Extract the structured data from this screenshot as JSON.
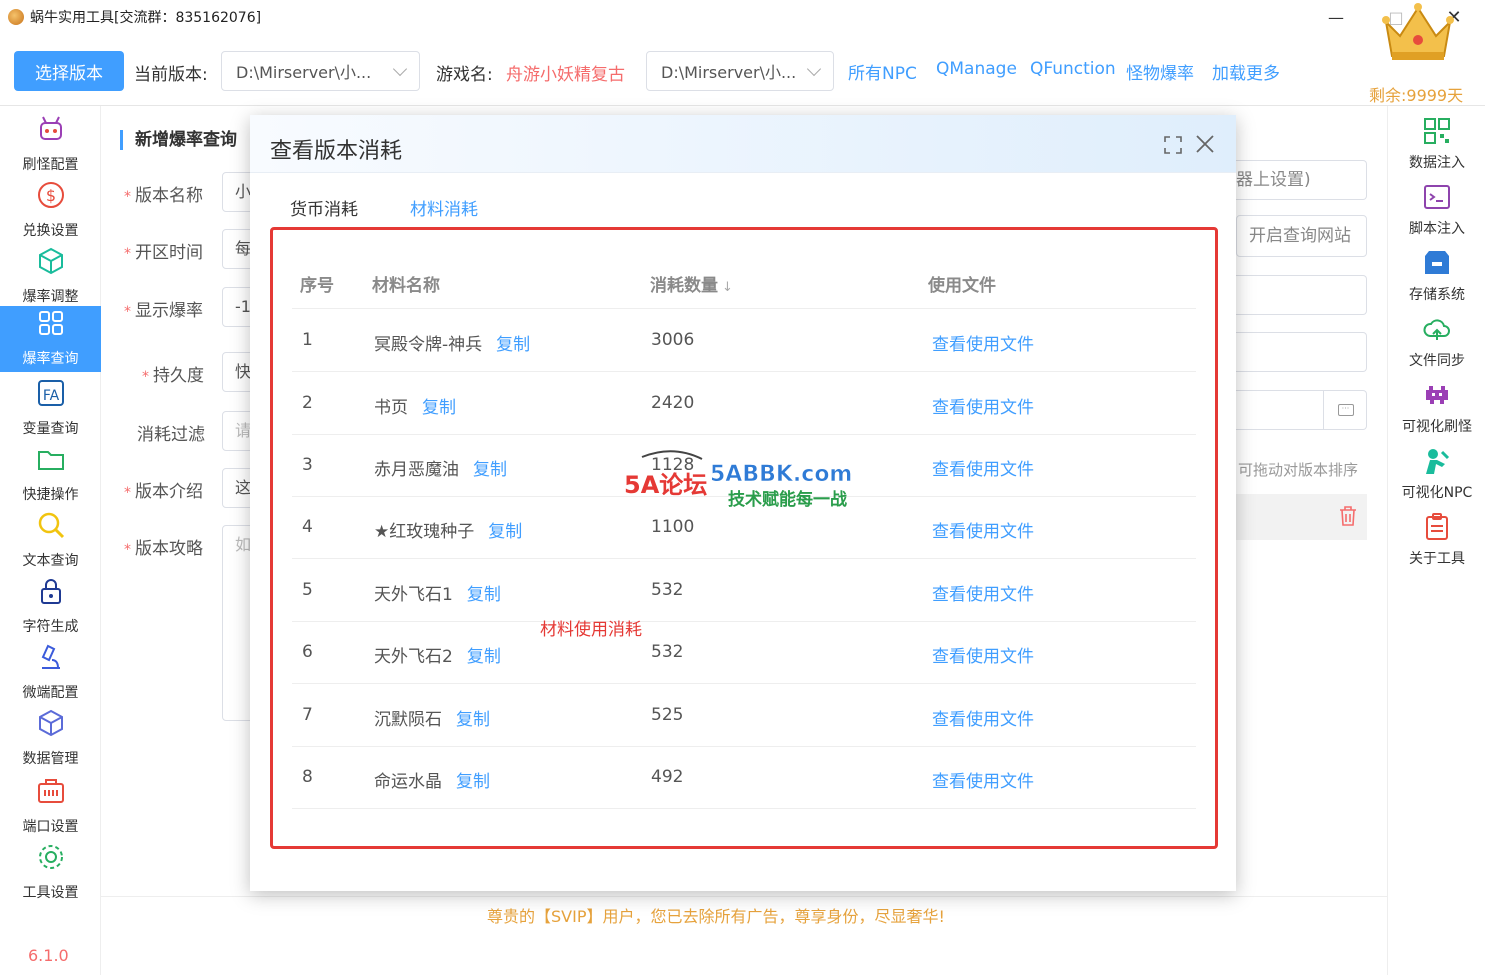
{
  "window": {
    "title": "蜗牛实用工具[交流群：835162076]",
    "minimize": "—",
    "maximize": "□",
    "close": "✕"
  },
  "toolbar": {
    "select_version_button": "选择版本",
    "current_version_label": "当前版本:",
    "current_version_value": "D:\\Mirserver\\小...",
    "game_name_label": "游戏名:",
    "game_name_value": "舟游小妖精复古",
    "server_path_value": "D:\\Mirserver\\小...",
    "links": [
      "所有NPC",
      "QManage",
      "QFunction",
      "怪物爆率",
      "加载更多"
    ],
    "remaining": "剩余:9999天"
  },
  "sidebar_left": {
    "items": [
      {
        "label": "刷怪配置",
        "icon": "robot-icon"
      },
      {
        "label": "兑换设置",
        "icon": "dollar-icon"
      },
      {
        "label": "爆率调整",
        "icon": "cube-icon"
      },
      {
        "label": "爆率查询",
        "icon": "grid-icon",
        "active": true
      },
      {
        "label": "变量查询",
        "icon": "formula-icon"
      },
      {
        "label": "快捷操作",
        "icon": "folder-icon"
      },
      {
        "label": "文本查询",
        "icon": "search-icon"
      },
      {
        "label": "字符生成",
        "icon": "lock-icon"
      },
      {
        "label": "微端配置",
        "icon": "microscope-icon"
      },
      {
        "label": "数据管理",
        "icon": "box-icon"
      },
      {
        "label": "端口设置",
        "icon": "port-icon"
      },
      {
        "label": "工具设置",
        "icon": "gear-icon"
      }
    ],
    "version": "6.1.0"
  },
  "sidebar_right": {
    "items": [
      {
        "label": "数据注入",
        "icon": "qr-icon"
      },
      {
        "label": "脚本注入",
        "icon": "terminal-icon"
      },
      {
        "label": "存储系统",
        "icon": "storage-icon"
      },
      {
        "label": "文件同步",
        "icon": "cloud-sync-icon"
      },
      {
        "label": "可视化刷怪",
        "icon": "invader-icon"
      },
      {
        "label": "可视化NPC",
        "icon": "npc-icon"
      },
      {
        "label": "关于工具",
        "icon": "clipboard-icon"
      }
    ]
  },
  "form": {
    "section_title": "新增爆率查询",
    "fields": [
      {
        "label": "版本名称",
        "required": true,
        "value": "小"
      },
      {
        "label": "开区时间",
        "required": true,
        "value": "每"
      },
      {
        "label": "显示爆率",
        "required": true,
        "value": "-1"
      },
      {
        "label": "持久度",
        "required": true,
        "value": "快"
      },
      {
        "label": "消耗过滤",
        "required": false,
        "value": "请"
      },
      {
        "label": "版本介绍",
        "required": true,
        "value": "这"
      },
      {
        "label": "版本攻略",
        "required": true,
        "value": "如"
      }
    ],
    "right_field_text": "器上设置)",
    "open_site_button": "开启查询网站",
    "drag_hint": "可拖动对版本排序"
  },
  "dialog": {
    "title": "查看版本消耗",
    "tabs": [
      "货币消耗",
      "材料消耗"
    ],
    "active_tab": "材料消耗",
    "columns": [
      "序号",
      "材料名称",
      "消耗数量",
      "使用文件"
    ],
    "sort_indicator": "↓",
    "copy_label": "复制",
    "rows": [
      {
        "idx": "1",
        "name": "冥殿令牌-神兵",
        "qty": "3006",
        "file": "查看使用文件"
      },
      {
        "idx": "2",
        "name": "书页",
        "qty": "2420",
        "file": "查看使用文件"
      },
      {
        "idx": "3",
        "name": "赤月恶魔油",
        "qty": "1128",
        "file": "查看使用文件"
      },
      {
        "idx": "4",
        "name": "★红玫瑰种子",
        "qty": "1100",
        "file": "查看使用文件"
      },
      {
        "idx": "5",
        "name": "天外飞石1",
        "qty": "532",
        "file": "查看使用文件"
      },
      {
        "idx": "6",
        "name": "天外飞石2",
        "qty": "532",
        "file": "查看使用文件"
      },
      {
        "idx": "7",
        "name": "沉默陨石",
        "qty": "525",
        "file": "查看使用文件"
      },
      {
        "idx": "8",
        "name": "命运水晶",
        "qty": "492",
        "file": "查看使用文件"
      }
    ],
    "annotation": "材料使用消耗"
  },
  "watermark": {
    "site_logo_text": "5A论坛",
    "site_domain": "5ABBK.com",
    "site_slogan": "技术赋能每一战"
  },
  "footer": {
    "notice": "尊贵的【SVIP】用户，您已去除所有广告，尊享身份，尽显奢华!"
  },
  "colors": {
    "primary": "#409eff",
    "danger": "#e53935",
    "warning": "#e6a23c"
  }
}
